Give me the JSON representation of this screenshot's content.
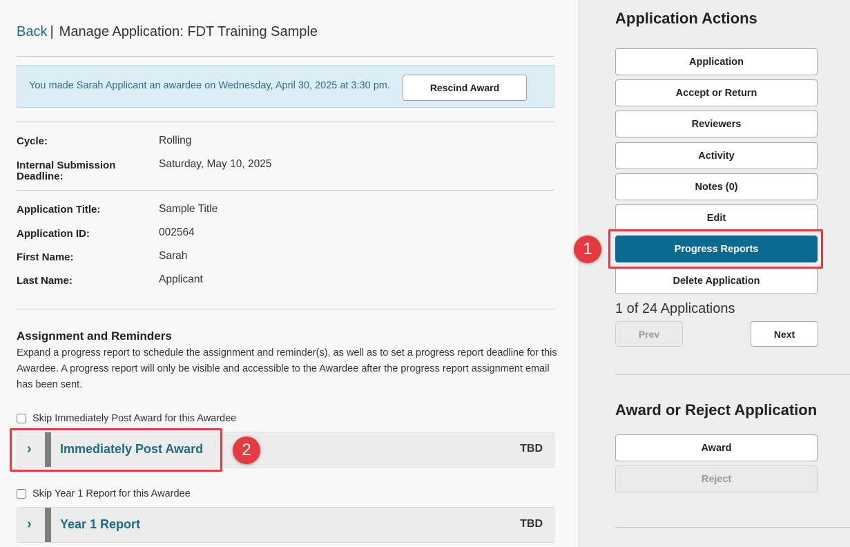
{
  "header": {
    "back": "Back",
    "separator": "|",
    "title": "Manage Application: FDT Training Sample"
  },
  "alert": {
    "text": "You made Sarah Applicant an awardee on Wednesday, April 30, 2025 at 3:30 pm.",
    "button": "Rescind Award"
  },
  "fields": {
    "cycle": {
      "label": "Cycle:",
      "value": "Rolling"
    },
    "deadline": {
      "label": "Internal Submission Deadline:",
      "value": "Saturday, May 10, 2025"
    },
    "app_title": {
      "label": "Application Title:",
      "value": "Sample Title"
    },
    "app_id": {
      "label": "Application ID:",
      "value": "002564"
    },
    "first_name": {
      "label": "First Name:",
      "value": "Sarah"
    },
    "last_name": {
      "label": "Last Name:",
      "value": "Applicant"
    }
  },
  "assignment": {
    "title": "Assignment and Reminders",
    "description": "Expand a progress report to schedule the assignment and reminder(s), as well as to set a progress report deadline for this Awardee. A progress report will only be visible and accessible to the Awardee after the progress report assignment email has been sent.",
    "reports": [
      {
        "skip_label": "Skip Immediately Post Award for this Awardee",
        "title": "Immediately Post Award",
        "status": "TBD"
      },
      {
        "skip_label": "Skip Year 1 Report for this Awardee",
        "title": "Year 1 Report",
        "status": "TBD"
      }
    ]
  },
  "sidebar": {
    "actions_title": "Application Actions",
    "actions": [
      "Application",
      "Accept or Return",
      "Reviewers",
      "Activity",
      "Notes (0)",
      "Edit",
      "Progress Reports",
      "Delete Application"
    ],
    "pagination": {
      "count_text": "1 of 24 Applications",
      "prev": "Prev",
      "next": "Next"
    },
    "award_title": "Award or Reject Application",
    "award": "Award",
    "reject": "Reject"
  },
  "annotations": {
    "badge1": "1",
    "badge2": "2",
    "color": "#e53a3f"
  },
  "colors": {
    "primary": "#0c6a91",
    "link": "#1a6b86",
    "alert_bg": "#dbeef6"
  }
}
